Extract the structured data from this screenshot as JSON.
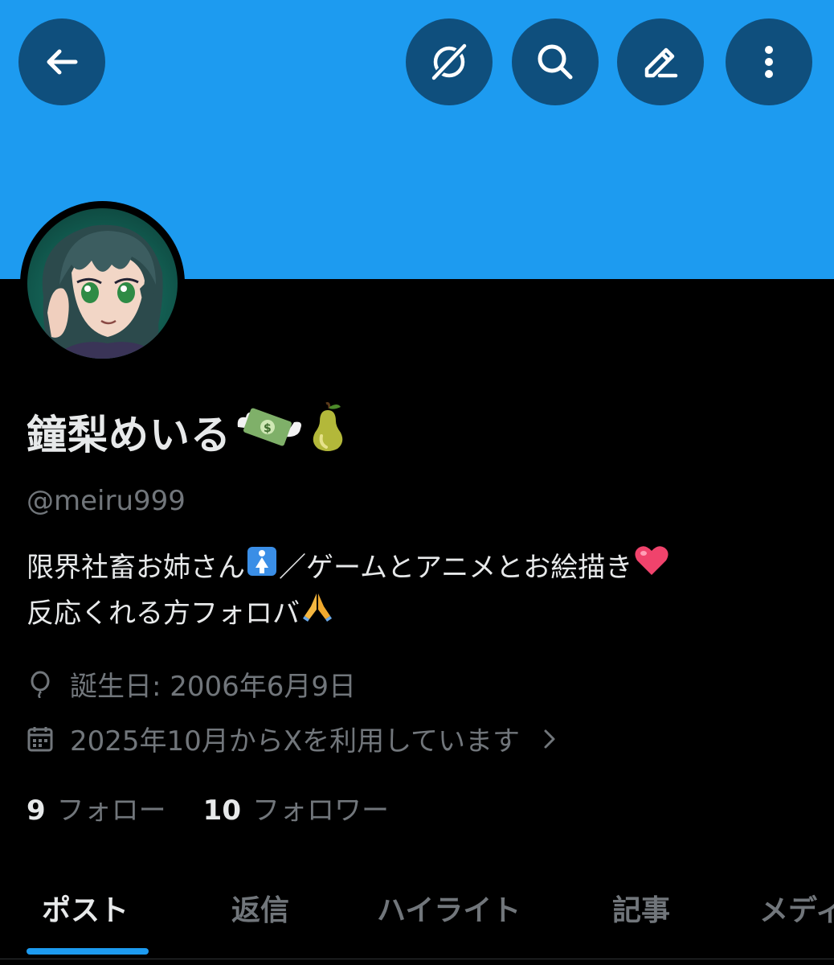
{
  "colors": {
    "banner": "#1d9bf0",
    "header_button_bg": "#0f4f7d",
    "background": "#000000",
    "primary_text": "#e7e9ea",
    "secondary_text": "#71767b",
    "accent": "#1d9bf0"
  },
  "header": {
    "icons": [
      "back-arrow-icon",
      "grok-icon",
      "search-icon",
      "edit-pencil-icon",
      "more-vertical-icon"
    ]
  },
  "profile": {
    "name": "鐘梨めいる",
    "name_emojis": [
      "money-with-wings-emoji",
      "pear-emoji"
    ],
    "handle": "@meiru999",
    "bio_line1_a": "限界社畜お姉さん",
    "bio_line1_b": "／ゲームとアニメとお絵描き",
    "bio_line2": "反応くれる方フォロバ",
    "bio_emojis": [
      "womens-room-emoji",
      "red-heart-emoji",
      "folded-hands-emoji"
    ],
    "birthday": "誕生日: 2006年6月9日",
    "joined": "2025年10月からXを利用しています"
  },
  "stats": {
    "following_count": "9",
    "following_label": "フォロー",
    "followers_count": "10",
    "followers_label": "フォロワー"
  },
  "tabs": [
    {
      "label": "ポスト",
      "active": true
    },
    {
      "label": "返信",
      "active": false
    },
    {
      "label": "ハイライト",
      "active": false
    },
    {
      "label": "記事",
      "active": false
    },
    {
      "label": "メディ",
      "active": false
    }
  ]
}
